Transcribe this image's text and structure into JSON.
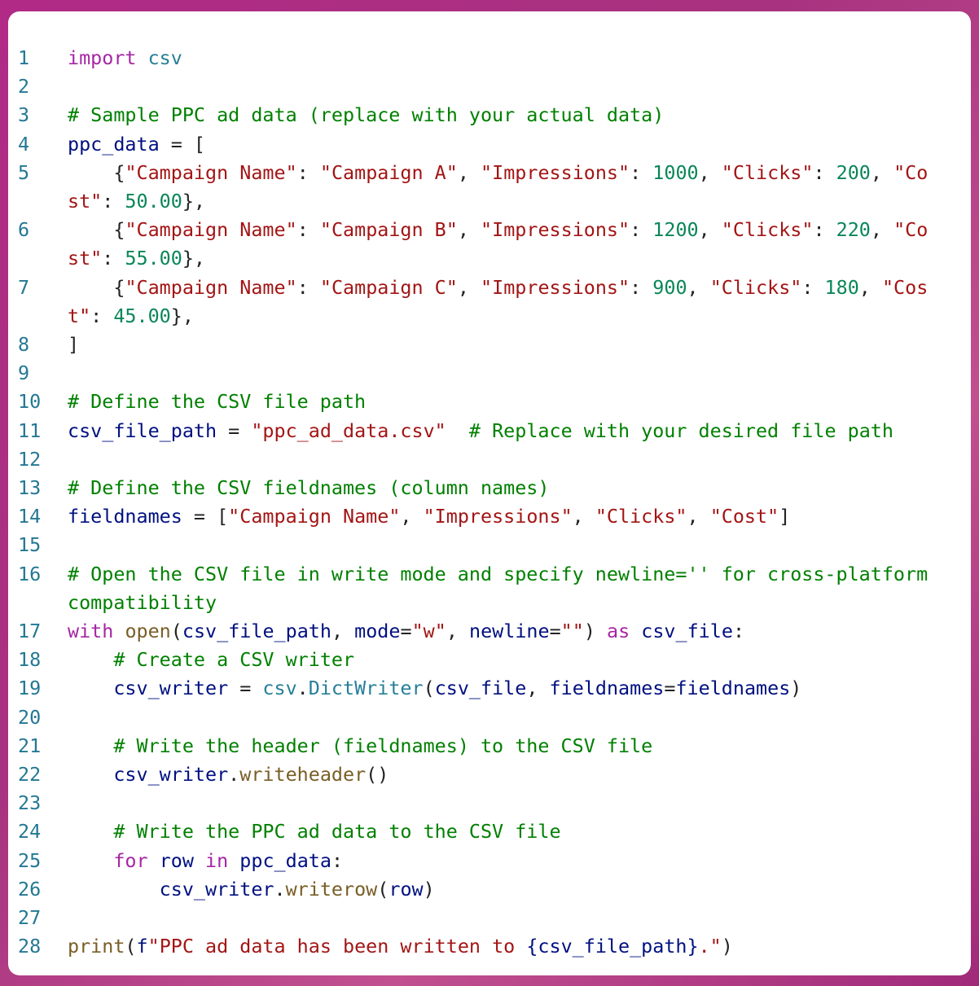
{
  "colors": {
    "keyword": "#a626a4",
    "module": "#267f99",
    "comment": "#008000",
    "string": "#a31515",
    "number": "#098658",
    "variable": "#001080",
    "function": "#795e26",
    "line_number": "#237893"
  },
  "lines": [
    [
      [
        "kw",
        "import"
      ],
      [
        "p",
        " "
      ],
      [
        "mod",
        "csv"
      ]
    ],
    [],
    [
      [
        "cm",
        "# Sample PPC ad data (replace with your actual data)"
      ]
    ],
    [
      [
        "var",
        "ppc_data"
      ],
      [
        "p",
        " = ["
      ]
    ],
    [
      [
        "p",
        "    {"
      ],
      [
        "str",
        "\"Campaign Name\""
      ],
      [
        "p",
        ": "
      ],
      [
        "str",
        "\"Campaign A\""
      ],
      [
        "p",
        ", "
      ],
      [
        "str",
        "\"Impressions\""
      ],
      [
        "p",
        ": "
      ],
      [
        "num",
        "1000"
      ],
      [
        "p",
        ", "
      ],
      [
        "str",
        "\"Clicks\""
      ],
      [
        "p",
        ": "
      ],
      [
        "num",
        "200"
      ],
      [
        "p",
        ", "
      ],
      [
        "str",
        "\"Cost\""
      ],
      [
        "p",
        ": "
      ],
      [
        "num",
        "50.00"
      ],
      [
        "p",
        "},"
      ]
    ],
    [
      [
        "p",
        "    {"
      ],
      [
        "str",
        "\"Campaign Name\""
      ],
      [
        "p",
        ": "
      ],
      [
        "str",
        "\"Campaign B\""
      ],
      [
        "p",
        ", "
      ],
      [
        "str",
        "\"Impressions\""
      ],
      [
        "p",
        ": "
      ],
      [
        "num",
        "1200"
      ],
      [
        "p",
        ", "
      ],
      [
        "str",
        "\"Clicks\""
      ],
      [
        "p",
        ": "
      ],
      [
        "num",
        "220"
      ],
      [
        "p",
        ", "
      ],
      [
        "str",
        "\"Cost\""
      ],
      [
        "p",
        ": "
      ],
      [
        "num",
        "55.00"
      ],
      [
        "p",
        "},"
      ]
    ],
    [
      [
        "p",
        "    {"
      ],
      [
        "str",
        "\"Campaign Name\""
      ],
      [
        "p",
        ": "
      ],
      [
        "str",
        "\"Campaign C\""
      ],
      [
        "p",
        ", "
      ],
      [
        "str",
        "\"Impressions\""
      ],
      [
        "p",
        ": "
      ],
      [
        "num",
        "900"
      ],
      [
        "p",
        ", "
      ],
      [
        "str",
        "\"Clicks\""
      ],
      [
        "p",
        ": "
      ],
      [
        "num",
        "180"
      ],
      [
        "p",
        ", "
      ],
      [
        "str",
        "\"Cost\""
      ],
      [
        "p",
        ": "
      ],
      [
        "num",
        "45.00"
      ],
      [
        "p",
        "},"
      ]
    ],
    [
      [
        "p",
        "]"
      ]
    ],
    [],
    [
      [
        "cm",
        "# Define the CSV file path"
      ]
    ],
    [
      [
        "var",
        "csv_file_path"
      ],
      [
        "p",
        " = "
      ],
      [
        "str",
        "\"ppc_ad_data.csv\""
      ],
      [
        "p",
        "  "
      ],
      [
        "cm",
        "# Replace with your desired file path"
      ]
    ],
    [],
    [
      [
        "cm",
        "# Define the CSV fieldnames (column names)"
      ]
    ],
    [
      [
        "var",
        "fieldnames"
      ],
      [
        "p",
        " = ["
      ],
      [
        "str",
        "\"Campaign Name\""
      ],
      [
        "p",
        ", "
      ],
      [
        "str",
        "\"Impressions\""
      ],
      [
        "p",
        ", "
      ],
      [
        "str",
        "\"Clicks\""
      ],
      [
        "p",
        ", "
      ],
      [
        "str",
        "\"Cost\""
      ],
      [
        "p",
        "]"
      ]
    ],
    [],
    [
      [
        "cm",
        "# Open the CSV file in write mode and specify newline='' for cross-platform compatibility"
      ]
    ],
    [
      [
        "kw",
        "with"
      ],
      [
        "p",
        " "
      ],
      [
        "fn",
        "open"
      ],
      [
        "p",
        "("
      ],
      [
        "var",
        "csv_file_path"
      ],
      [
        "p",
        ", "
      ],
      [
        "var",
        "mode"
      ],
      [
        "p",
        "="
      ],
      [
        "str",
        "\"w\""
      ],
      [
        "p",
        ", "
      ],
      [
        "var",
        "newline"
      ],
      [
        "p",
        "="
      ],
      [
        "str",
        "\"\""
      ],
      [
        "p",
        ") "
      ],
      [
        "kw",
        "as"
      ],
      [
        "p",
        " "
      ],
      [
        "var",
        "csv_file"
      ],
      [
        "p",
        ":"
      ]
    ],
    [
      [
        "p",
        "    "
      ],
      [
        "cm",
        "# Create a CSV writer"
      ]
    ],
    [
      [
        "p",
        "    "
      ],
      [
        "var",
        "csv_writer"
      ],
      [
        "p",
        " = "
      ],
      [
        "mod",
        "csv"
      ],
      [
        "p",
        "."
      ],
      [
        "mod",
        "DictWriter"
      ],
      [
        "p",
        "("
      ],
      [
        "var",
        "csv_file"
      ],
      [
        "p",
        ", "
      ],
      [
        "var",
        "fieldnames"
      ],
      [
        "p",
        "="
      ],
      [
        "var",
        "fieldnames"
      ],
      [
        "p",
        ")"
      ]
    ],
    [],
    [
      [
        "p",
        "    "
      ],
      [
        "cm",
        "# Write the header (fieldnames) to the CSV file"
      ]
    ],
    [
      [
        "p",
        "    "
      ],
      [
        "var",
        "csv_writer"
      ],
      [
        "p",
        "."
      ],
      [
        "fn",
        "writeheader"
      ],
      [
        "p",
        "()"
      ]
    ],
    [],
    [
      [
        "p",
        "    "
      ],
      [
        "cm",
        "# Write the PPC ad data to the CSV file"
      ]
    ],
    [
      [
        "p",
        "    "
      ],
      [
        "kw",
        "for"
      ],
      [
        "p",
        " "
      ],
      [
        "var",
        "row"
      ],
      [
        "p",
        " "
      ],
      [
        "kw",
        "in"
      ],
      [
        "p",
        " "
      ],
      [
        "var",
        "ppc_data"
      ],
      [
        "p",
        ":"
      ]
    ],
    [
      [
        "p",
        "        "
      ],
      [
        "var",
        "csv_writer"
      ],
      [
        "p",
        "."
      ],
      [
        "fn",
        "writerow"
      ],
      [
        "p",
        "("
      ],
      [
        "var",
        "row"
      ],
      [
        "p",
        ")"
      ]
    ],
    [],
    [
      [
        "fn",
        "print"
      ],
      [
        "p",
        "("
      ],
      [
        "var",
        "f"
      ],
      [
        "str",
        "\"PPC ad data has been written to "
      ],
      [
        "var",
        "{csv_file_path}"
      ],
      [
        "str",
        ".\""
      ],
      [
        "p",
        ")"
      ]
    ]
  ]
}
